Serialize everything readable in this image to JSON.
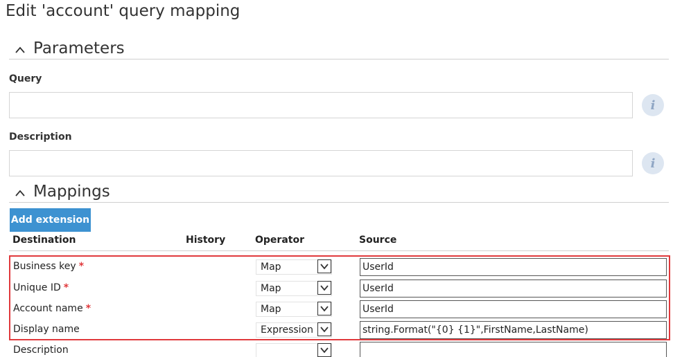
{
  "page": {
    "title": "Edit 'account' query mapping"
  },
  "parameters": {
    "section_label": "Parameters",
    "query_label": "Query",
    "query_value": "",
    "description_label": "Description",
    "description_value": "",
    "info_glyph": "i"
  },
  "mappings": {
    "section_label": "Mappings",
    "add_extension_label": "Add extension",
    "columns": {
      "destination": "Destination",
      "history": "History",
      "operator": "Operator",
      "source": "Source"
    },
    "required_marker": "*",
    "rows": [
      {
        "destination": "Business key",
        "required": true,
        "operator": "Map",
        "source": "UserId"
      },
      {
        "destination": "Unique ID",
        "required": true,
        "operator": "Map",
        "source": "UserId"
      },
      {
        "destination": "Account name",
        "required": true,
        "operator": "Map",
        "source": "UserId"
      },
      {
        "destination": "Display name",
        "required": false,
        "operator": "Expression",
        "source": "string.Format(\"{0} {1}\",FirstName,LastName)"
      },
      {
        "destination": "Description",
        "required": false,
        "operator": "",
        "source": ""
      }
    ]
  },
  "icons": {
    "collapse": "chevron-up-icon",
    "dropdown": "chevron-down-icon",
    "info": "info-icon"
  },
  "colors": {
    "accent_button": "#3d92d1",
    "highlight_border": "#e0393c",
    "required_marker": "#e0393c",
    "info_bg": "#dde6f1"
  }
}
